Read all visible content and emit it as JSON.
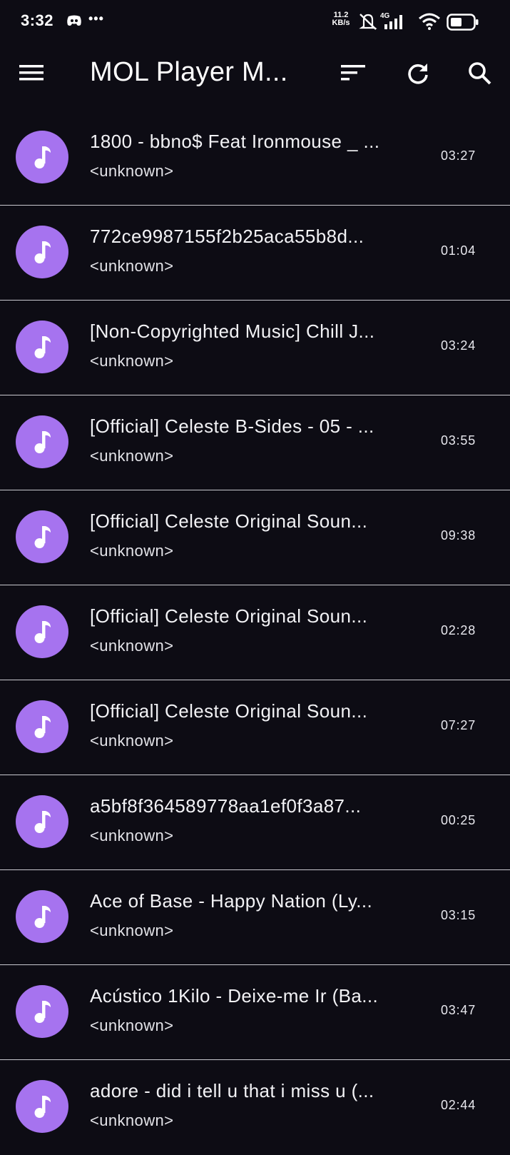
{
  "status_bar": {
    "time": "3:32",
    "net_speed_value": "11.2",
    "net_speed_unit": "KB/s",
    "network_type": "4G",
    "icons": [
      "discord-icon",
      "more-dots-icon",
      "mute-icon",
      "signal-icon",
      "wifi-icon",
      "battery-icon"
    ]
  },
  "app_bar": {
    "title": "MOL Player M...",
    "icons": [
      "menu-icon",
      "sort-icon",
      "refresh-icon",
      "search-icon"
    ]
  },
  "songs": [
    {
      "title": "1800 - bbno$ Feat Ironmouse _ ...",
      "artist": "<unknown>",
      "duration": "03:27"
    },
    {
      "title": "772ce9987155f2b25aca55b8d...",
      "artist": "<unknown>",
      "duration": "01:04"
    },
    {
      "title": "[Non-Copyrighted Music] Chill J...",
      "artist": "<unknown>",
      "duration": "03:24"
    },
    {
      "title": "[Official] Celeste B-Sides - 05 - ...",
      "artist": "<unknown>",
      "duration": "03:55"
    },
    {
      "title": "[Official] Celeste Original Soun...",
      "artist": "<unknown>",
      "duration": "09:38"
    },
    {
      "title": "[Official] Celeste Original Soun...",
      "artist": "<unknown>",
      "duration": "02:28"
    },
    {
      "title": "[Official] Celeste Original Soun...",
      "artist": "<unknown>",
      "duration": "07:27"
    },
    {
      "title": "a5bf8f364589778aa1ef0f3a87...",
      "artist": "<unknown>",
      "duration": "00:25"
    },
    {
      "title": "Ace of Base - Happy Nation (Ly...",
      "artist": "<unknown>",
      "duration": "03:15"
    },
    {
      "title": "Acústico 1Kilo - Deixe-me Ir (Ba...",
      "artist": "<unknown>",
      "duration": "03:47"
    },
    {
      "title": "adore - did i tell u that i miss u (...",
      "artist": "<unknown>",
      "duration": "02:44"
    }
  ],
  "colors": {
    "background": "#0d0c14",
    "avatar": "#a673ef",
    "divider": "#c9c9cf",
    "text": "#ffffff"
  }
}
